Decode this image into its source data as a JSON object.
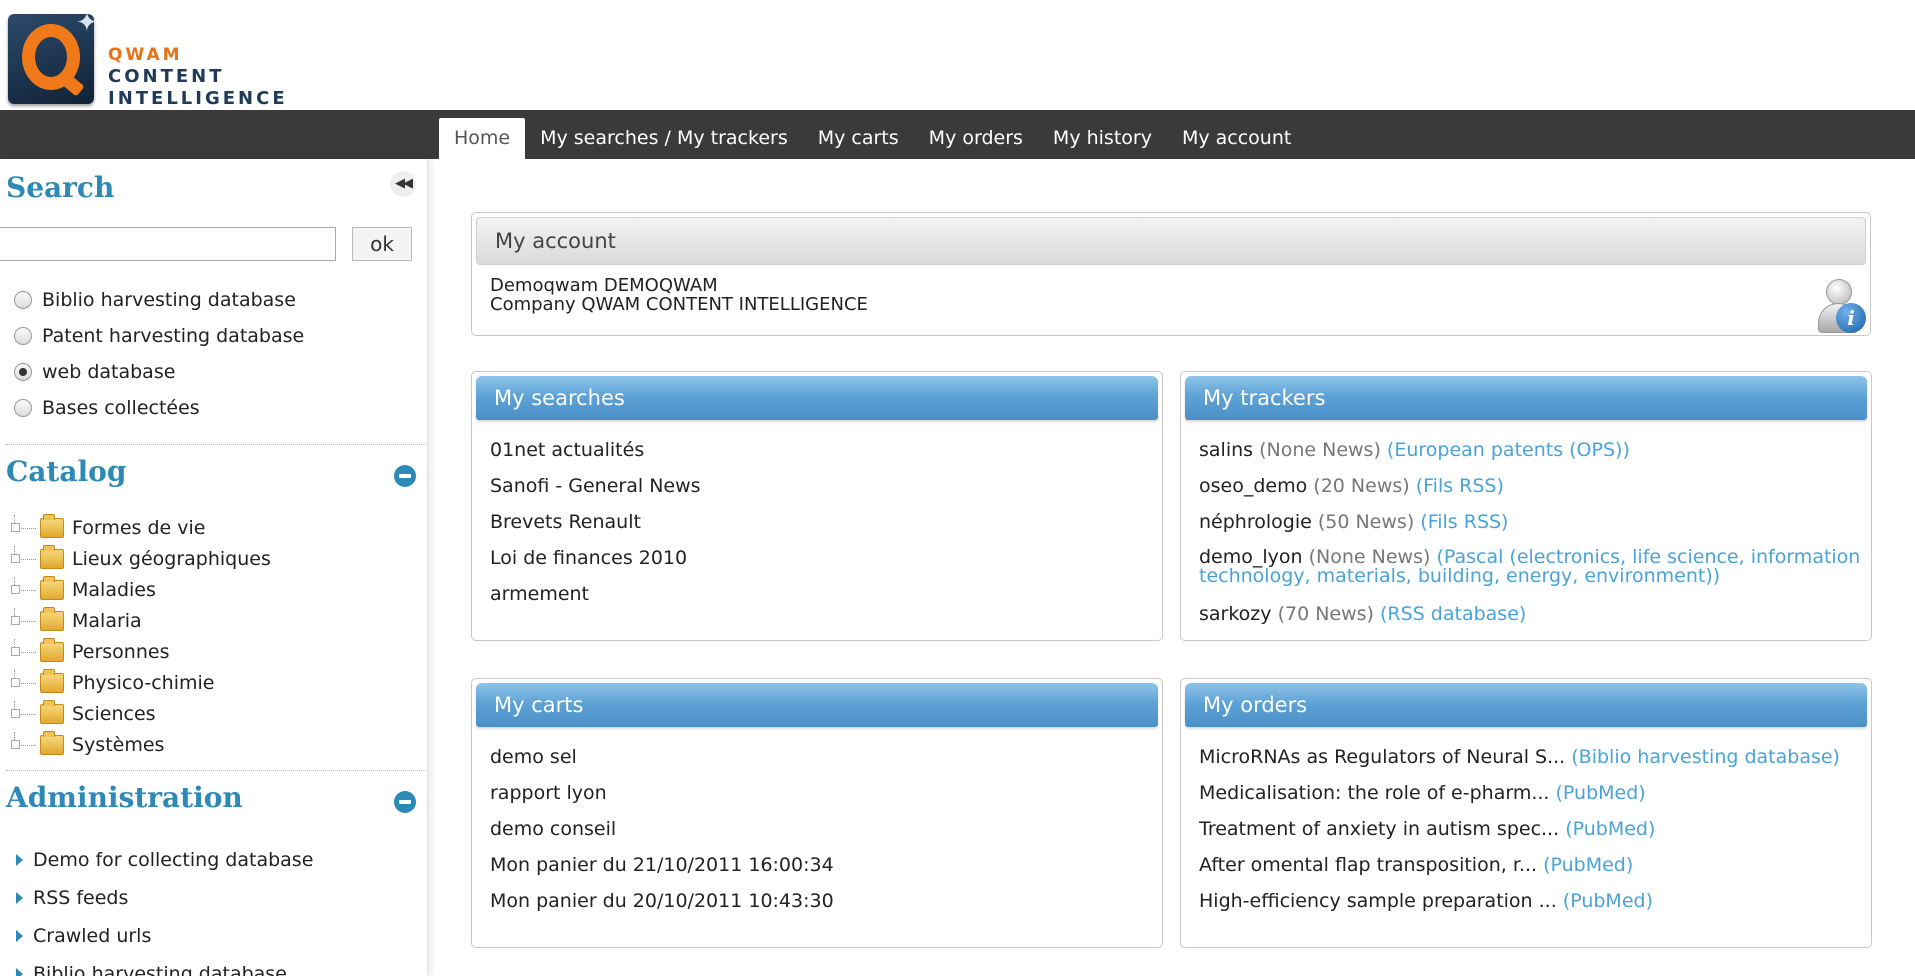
{
  "brand": {
    "line1": "QWAM",
    "line2": "CONTENT",
    "line3": "INTELLIGENCE",
    "logo_letter": "Q",
    "accent": "#e8731a",
    "navy": "#1f3a5a"
  },
  "nav": {
    "items": [
      {
        "label": "Home",
        "active": true
      },
      {
        "label": "My searches / My trackers"
      },
      {
        "label": "My carts"
      },
      {
        "label": "My orders"
      },
      {
        "label": "My history"
      },
      {
        "label": "My account"
      }
    ]
  },
  "sidebar": {
    "collapse_icon": "double-chevron-left-icon",
    "search": {
      "title": "Search",
      "input_value": "",
      "ok_label": "ok",
      "options": [
        {
          "label": "Biblio harvesting database",
          "checked": false
        },
        {
          "label": "Patent harvesting database",
          "checked": false
        },
        {
          "label": "web database",
          "checked": true
        },
        {
          "label": "Bases collectées",
          "checked": false
        }
      ]
    },
    "catalog": {
      "title": "Catalog",
      "items": [
        "Formes de vie",
        "Lieux géographiques",
        "Maladies",
        "Malaria",
        "Personnes",
        "Physico-chimie",
        "Sciences",
        "Systèmes"
      ]
    },
    "administration": {
      "title": "Administration",
      "items": [
        "Demo for collecting database",
        "RSS feeds",
        "Crawled urls",
        "Biblio harvesting database"
      ]
    }
  },
  "account": {
    "title": "My account",
    "name_line": "Demoqwam DEMOQWAM",
    "company_line": "Company QWAM CONTENT INTELLIGENCE"
  },
  "searches": {
    "title": "My searches",
    "items": [
      "01net actualités",
      "Sanofi - General News",
      "Brevets Renault",
      "Loi de finances 2010",
      "armement"
    ]
  },
  "trackers": {
    "title": "My trackers",
    "items": [
      {
        "name": "salins",
        "count": "(None News)",
        "source": "(European patents (OPS))"
      },
      {
        "name": "oseo_demo",
        "count": "(20 News)",
        "source": "(Fils RSS)"
      },
      {
        "name": "néphrologie",
        "count": "(50 News)",
        "source": "(Fils RSS)"
      },
      {
        "name": "demo_lyon",
        "count": "(None News)",
        "source": "(Pascal (electronics, life science, information technology, materials, building, energy, environment))"
      },
      {
        "name": "sarkozy",
        "count": "(70 News)",
        "source": "(RSS database)"
      }
    ]
  },
  "carts": {
    "title": "My carts",
    "items": [
      "demo sel",
      "rapport lyon",
      "demo conseil",
      "Mon panier du 21/10/2011 16:00:34",
      "Mon panier du 20/10/2011 10:43:30"
    ]
  },
  "orders": {
    "title": "My orders",
    "items": [
      {
        "title": "MicroRNAs as Regulators of Neural S...",
        "source": "(Biblio harvesting database)"
      },
      {
        "title": "Medicalisation: the role of e-pharm...",
        "source": "(PubMed)"
      },
      {
        "title": "Treatment of anxiety in autism spec...",
        "source": "(PubMed)"
      },
      {
        "title": "After omental flap transposition, r...",
        "source": "(PubMed)"
      },
      {
        "title": "High-efficiency sample preparation ...",
        "source": "(PubMed)"
      }
    ]
  }
}
